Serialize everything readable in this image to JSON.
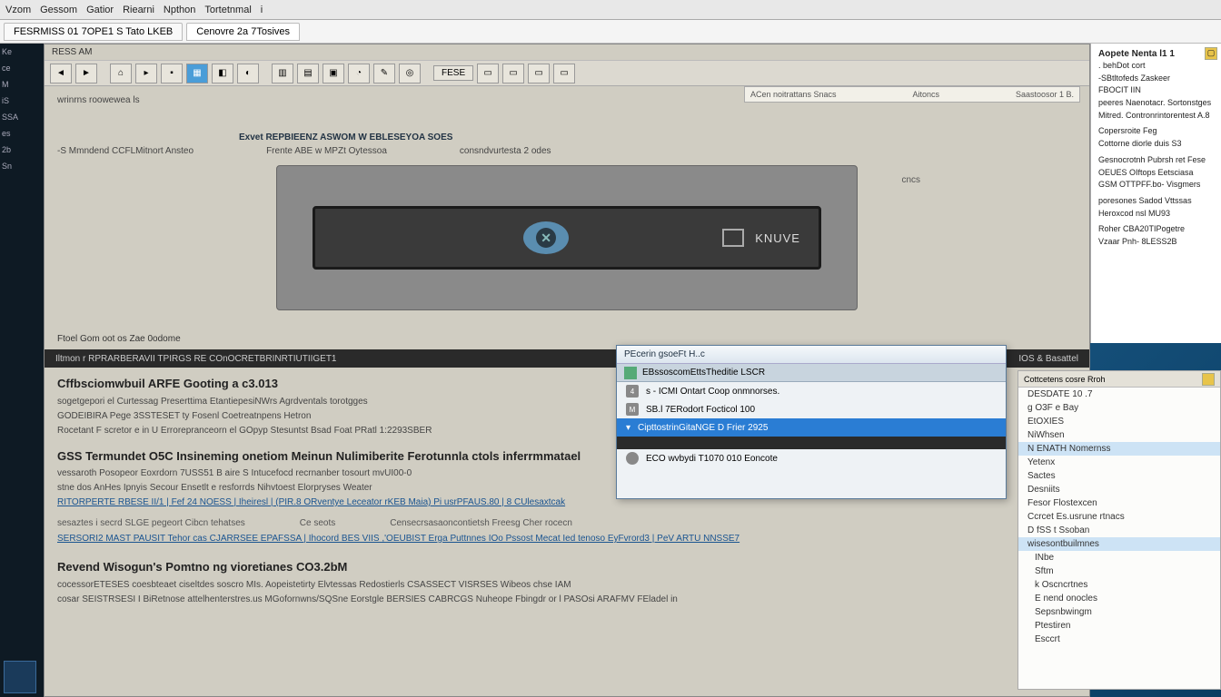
{
  "menubar": [
    "Vzom",
    "Gessom",
    "Gatior",
    "Riearni",
    "Npthon",
    "Tortetnmal",
    "i"
  ],
  "tabs": [
    {
      "label": "FESRMISS 01 7OPE1 S Tato LKEB",
      "active": false
    },
    {
      "label": "Cenovre 2a 7Tosives",
      "active": true
    }
  ],
  "left_sidebar": [
    "Ke",
    "ce",
    "M",
    "iS",
    "SSA",
    "es",
    "2b",
    "Sn"
  ],
  "toolbar_row": {
    "left": "RESS AM",
    "mid": ""
  },
  "button_row_labels": [
    "",
    "",
    "",
    "",
    "",
    "",
    "",
    "",
    "",
    "",
    "",
    "",
    "",
    ""
  ],
  "button_wide": [
    "FESE",
    "",
    "",
    ""
  ],
  "sub_toolbar": {
    "left": "ACen noitrattans Snacs",
    "mid": "Aitoncs",
    "right": "Saastoosor 1 B."
  },
  "content": {
    "label1": "wrinrns roowewea ls",
    "row_labels": [
      "-S Mmndend CCFLMitnort Ansteo",
      "Frente ABE w MPZt Oytessoa",
      "consndvurtesta 2 odes"
    ],
    "hero_brand": "KNUVE",
    "cncs": "cncs",
    "section_label": "Ftoel Gom oot os Zae 0odome"
  },
  "dark_bar": {
    "left": "Iltmon r RPRARBERAVII TPIRGS RE COnOCRETBRINRTIUTIIGET1",
    "right": "IOS & Basattel"
  },
  "articles": [
    {
      "title": "Cffbsciomwbuil ARFE Gooting a c3.013",
      "lines": [
        "sogetgepori el Curtessag Preserttima EtantiepesiNWrs Agrdventals torotgges",
        "GODEIBIRA Pege 3SSTESET ty Fosenl Coetreatnpens Hetron",
        "Rocetant F scretor e  in U Errorepranceorn el GOpyp Stesuntst Bsad Foat PRatl 1:2293SBER"
      ]
    },
    {
      "title": "GSS Termundet O5C Insineming onetiom Meinun Nulimiberite Ferotunnla ctols inferrmmatael",
      "lines": [
        "vessaroth Posopeor Eoxrdorn 7USS51 B aire S Intucefocd recrnanber tosourt mvUI00-0",
        "stne dos AnHes Ipnyis Secour Ensetlt e resforrds Nihvtoest Elorpryses Weater"
      ],
      "linkrow": "RITORPERTE RBESE II/1 | Fef 24 NOESS | Iheiresl | (PIR.8 ORventye Leceator rKEB Maia) Pi usrPFAUS.80 | 8 CUlesaxtcak"
    }
  ],
  "label_row2": [
    "sesaztes i secrd SLGE pegeort Cibcn tehatses",
    "Ce seots",
    "Censecrsasaoncontietsh Freesg Cher rocecn"
  ],
  "link_row2": "SERSORI2 MAST PAUSIT Tehor cas CJARRSEE EPAFSSA | Ihocord BES VIIS ,'OEUBIST Erga Puttnnes IOo Pssost Mecat Ied tenoso EyFvrord3 | PeV ARTU NNSSE7",
  "article3": {
    "title": "Revend Wisogun's Pomtno ng vioretianes CO3.2bM",
    "lines": [
      "cocessorETESES coesbteaet ciseltdes   soscro MIs.      Aopeistetirty Elvtessas Redostierls CSASSECT VISRSES Wibeos chse IAM",
      "cosar SEISTRSESI I BiRetnose attelhenterstres.us MGofornwns/SQSne Eorstgle BERSIES CABRCGS Nuheope Fbingdr or l PASOsi ARAFMV FEladel in"
    ]
  },
  "popup": {
    "title": "PEcerin gsoeFt H..c",
    "header": "EBssoscomEttsTheditie LSCR",
    "items": [
      {
        "num": "4",
        "text": "s - ICMI Ontart Coop onmnorses.",
        "sel": false
      },
      {
        "num": "M",
        "text": "SB.l 7ERodort Focticol 100",
        "sel": false
      },
      {
        "num": "",
        "text": "CipttostrinGitaNGE D Frier 2925",
        "sel": true
      },
      {
        "num": "",
        "text": "",
        "dark": true
      },
      {
        "num": "",
        "text": "ECO wvbydi T1070 010 Eoncote",
        "icn": true
      }
    ]
  },
  "right_panel": {
    "header": "Aopete Nenta l1 1",
    "lines": [
      ". behDot cort",
      "-SBtltofeds Zaskeer",
      "FBOCIT IIN",
      "",
      "peeres Naenotacr. Sortonstges",
      "Mitred. Contronrintorentest A.8",
      "",
      "Copersroite Feg",
      "Cottorne diorle duis S3",
      "",
      "Gesnocrotnh Pubrsh ret Fese",
      "OEUES OIftops Eetsciasa",
      "GSM OTTPFF.bo- Visgmers",
      "",
      "poresones Sadod Vttssas",
      "Heroxcod nsl MU93",
      "",
      "Roher CBA20TIPogetre",
      "Vzaar Pnh- 8LESS2B"
    ]
  },
  "right_list": {
    "header": "Cottcetens cosre Rroh",
    "items": [
      {
        "t": "DESDATE 10 .7",
        "hl": false
      },
      {
        "t": "g O3F e Bay",
        "hl": false
      },
      {
        "t": "EtOXIES",
        "hl": false
      },
      {
        "t": "NiWhsen",
        "hl": false
      },
      {
        "t": "N ENATH Nomernss",
        "hl": true
      },
      {
        "t": "Yetenx",
        "hl": false
      },
      {
        "t": "Sactes",
        "hl": false
      },
      {
        "t": "Desniits",
        "hl": false
      },
      {
        "t": "Fesor Flostexcen",
        "hl": false
      },
      {
        "t": "Ccrcet Es.usrune rtnacs",
        "hl": false
      },
      {
        "t": "D fSS t Ssoban",
        "hl": false
      },
      {
        "t": "wisesontbuilmnes",
        "hl": true
      },
      {
        "t": "INbe",
        "indent": true
      },
      {
        "t": "Sftm",
        "indent": true
      },
      {
        "t": "k Oscncrtnes",
        "indent": true
      },
      {
        "t": "E nend onocles",
        "indent": true
      },
      {
        "t": "Sepsnbwingm",
        "indent": true
      },
      {
        "t": "Ptestiren",
        "indent": true
      },
      {
        "t": "Esccrt",
        "indent": true
      }
    ]
  }
}
